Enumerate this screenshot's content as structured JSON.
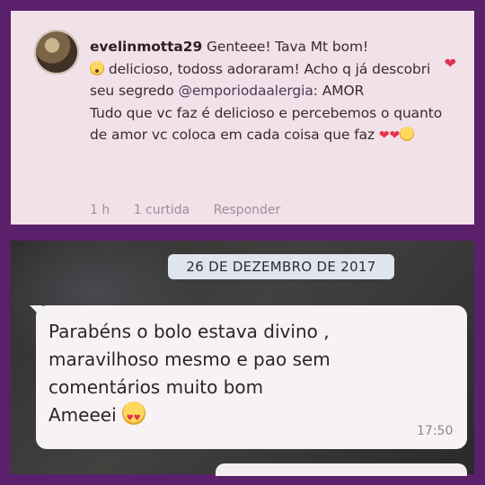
{
  "comment": {
    "username": "evelinmotta29",
    "text_part1": " Genteee! Tava Mt bom!",
    "text_part2": " delicioso, todoss adoraram! Acho q já descobri seu segredo ",
    "mention": "@emporiodaalergia",
    "text_part3": ": AMOR",
    "text_part4": "Tudo que vc faz é delicioso e percebemos o quanto de amor vc coloca em cada coisa que faz",
    "time": "1 h",
    "likes": "1 curtida",
    "reply": "Responder"
  },
  "chat": {
    "date": "26 DE DEZEMBRO DE 2017",
    "message_line1": "Parabéns o bolo estava divino ,",
    "message_line2": "maravilhoso mesmo e pao sem",
    "message_line3": "comentários muito bom",
    "message_line4": "Ameeei",
    "time": "17:50"
  },
  "icons": {
    "like": "heart-icon",
    "shocked": "shocked-face-emoji",
    "hearts": "red-heart-emoji",
    "kiss": "kiss-face-emoji",
    "heart_eyes": "heart-eyes-emoji"
  },
  "colors": {
    "frame": "#5b206c",
    "comment_bg": "#f1e2ea",
    "like_heart": "#e0344e",
    "bubble": "#f7f3f4",
    "date_chip": "#dfe5ef"
  }
}
